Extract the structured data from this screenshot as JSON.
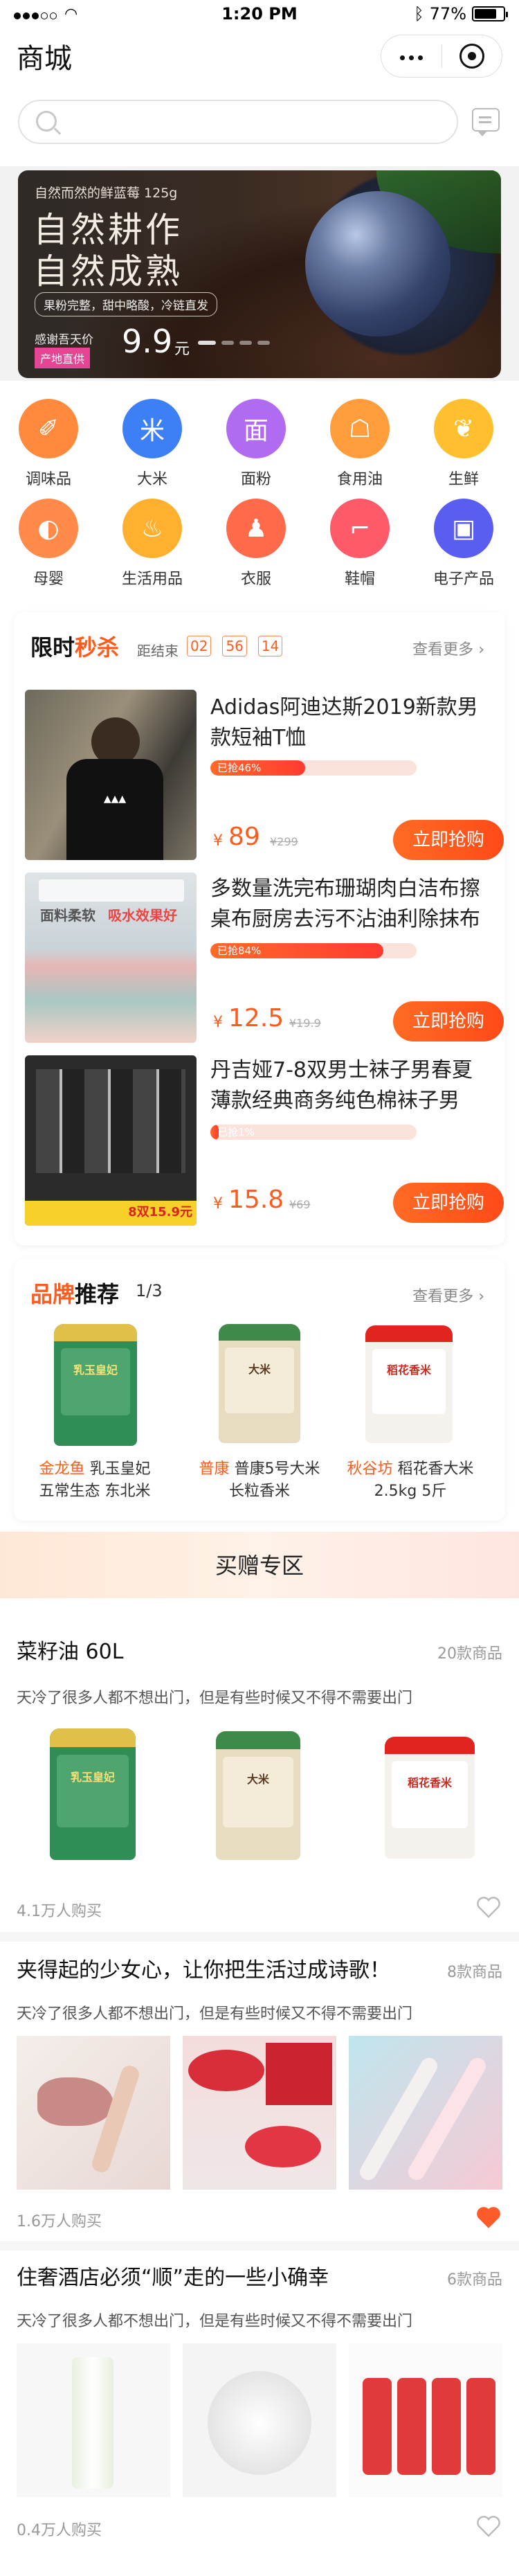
{
  "status": {
    "time": "1:20 PM",
    "battery": "77%",
    "battery_level": 0.77
  },
  "header": {
    "title": "商城"
  },
  "banner": {
    "subtitle": "自然而然的鲜蓝莓 125g",
    "title_line1": "自然耕作",
    "title_line2": "自然成熟",
    "tag": "果粉完整，甜中略酸，冷链直发",
    "price_prefix": "感谢吾天价",
    "badge": "产地直供",
    "price": "9.9",
    "unit": "元"
  },
  "categories": [
    {
      "label": "调味品",
      "color": "#ff8a3d",
      "icon": "seasoning-icon",
      "glyph": "✐"
    },
    {
      "label": "大米",
      "color": "#3d7ff5",
      "icon": "rice-icon",
      "glyph": "米"
    },
    {
      "label": "面粉",
      "color": "#b06bf0",
      "icon": "flour-icon",
      "glyph": "面"
    },
    {
      "label": "食用油",
      "color": "#ff9d3d",
      "icon": "oil-icon",
      "glyph": "☖"
    },
    {
      "label": "生鲜",
      "color": "#ffbf2e",
      "icon": "fresh-icon",
      "glyph": "❦"
    },
    {
      "label": "母婴",
      "color": "#ff8a4a",
      "icon": "baby-icon",
      "glyph": "◐"
    },
    {
      "label": "生活用品",
      "color": "#ffb02e",
      "icon": "daily-icon",
      "glyph": "♨"
    },
    {
      "label": "衣服",
      "color": "#ff6a4a",
      "icon": "clothes-icon",
      "glyph": "♟"
    },
    {
      "label": "鞋帽",
      "color": "#ff5a6a",
      "icon": "shoes-icon",
      "glyph": "⌐"
    },
    {
      "label": "电子产品",
      "color": "#5a5ef0",
      "icon": "electronics-icon",
      "glyph": "▣"
    }
  ],
  "flash_sale": {
    "title_a": "限时",
    "title_b": "秒杀",
    "countdown_label": "距结束",
    "countdown": [
      "02",
      "56",
      "14"
    ],
    "see_more": "查看更多",
    "items": [
      {
        "name": "Adidas阿迪达斯2019新款男款短袖T恤",
        "sold_label": "已抢46%",
        "sold": 0.46,
        "price": "89",
        "orig": "¥299",
        "button": "立即抢购"
      },
      {
        "name": "多数量洗完布珊瑚肉白洁布擦桌布厨房去污不沾油利除抹布",
        "sold_label": "已抢84%",
        "sold": 0.84,
        "price": "12.5",
        "orig": "¥19.9",
        "button": "立即抢购",
        "img_label_a": "面料柔软",
        "img_label_b": "吸水效果好"
      },
      {
        "name": "丹吉娅7-8双男士袜子男春夏薄款经典商务纯色棉袜子男",
        "sold_label": "已抢1%",
        "sold": 0.01,
        "price": "15.8",
        "orig": "¥69",
        "button": "立即抢购",
        "img_label_a": "8双15.9元"
      }
    ]
  },
  "brand": {
    "title_a": "品牌",
    "title_b": "推荐",
    "page": "1/3",
    "see_more": "查看更多",
    "items": [
      {
        "brand": "金龙鱼",
        "line1_rest": "乳玉皇妃",
        "line2": "五常生态  东北米",
        "bag_text": "乳玉皇妃"
      },
      {
        "brand": "普康",
        "line1_rest": "普康5号大米",
        "line2": "长粒香米",
        "bag_text": "大米"
      },
      {
        "brand": "秋谷坊",
        "line1_rest": "稻花香大米",
        "line2": "2.5kg 5斤",
        "bag_text": "稻花香米"
      }
    ]
  },
  "gift_zone": {
    "title": "买赠专区",
    "lists": [
      {
        "title": "菜籽油   60L",
        "count": "20款商品",
        "desc": "天冷了很多人都不想出门，但是有些时候又不得不需要出门",
        "buyers": "4.1万人购买",
        "liked": false
      },
      {
        "title": "夹得起的少女心，让你把生活过成诗歌！",
        "count": "8款商品",
        "desc": "天冷了很多人都不想出门，但是有些时候又不得不需要出门",
        "buyers": "1.6万人购买",
        "liked": true
      },
      {
        "title": "住奢酒店必须“顺”走的一些小确幸",
        "count": "6款商品",
        "desc": "天冷了很多人都不想出门，但是有些时候又不得不需要出门",
        "buyers": "0.4万人购买",
        "liked": false
      }
    ]
  }
}
